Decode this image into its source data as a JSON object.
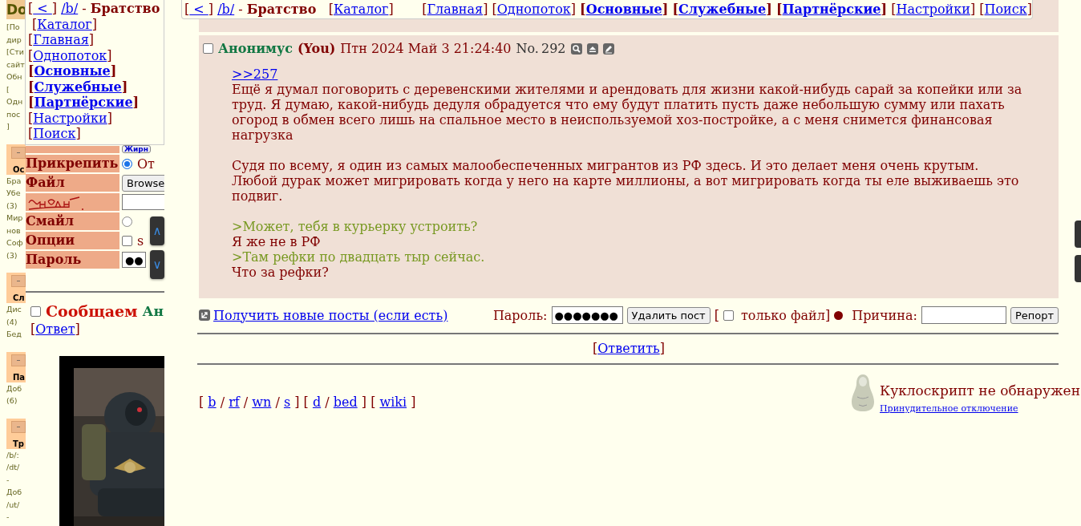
{
  "sidebar": {
    "title": "Do",
    "intro": [
      "[По",
      "дир",
      "[Сти",
      "сайт",
      "Обн",
      "[",
      "Одн",
      "пос",
      "]"
    ],
    "sections": [
      {
        "toggle": "–",
        "title": "Ос",
        "lines": [
          "Бра",
          "Убе",
          "(3)",
          "Мир",
          "нов",
          "Соф",
          "(3)"
        ]
      },
      {
        "toggle": "–",
        "title": "Сл",
        "lines": [
          "Дис",
          "(4)",
          "Бед"
        ]
      },
      {
        "toggle": "–",
        "title": "Па",
        "lines": [
          "Доб",
          "(6)"
        ]
      },
      {
        "toggle": "–",
        "title": "Тр",
        "lines": [
          "/b/:",
          "/dt/",
          "-",
          "Доб",
          "/ut/",
          "-"
        ]
      }
    ]
  },
  "menu": {
    "brackets": [
      "[",
      "]"
    ],
    "back": " < ",
    "board": "/b/",
    "sep": "-",
    "title": "Братство",
    "links": [
      {
        "label": "Каталог",
        "bold": false
      },
      {
        "label": "Главная",
        "bold": false
      },
      {
        "label": "Однопоток",
        "bold": false
      },
      {
        "label": "Основные",
        "bold": true
      },
      {
        "label": "Служебные",
        "bold": true
      },
      {
        "label": "Партнёрские",
        "bold": true
      },
      {
        "label": "Настройки",
        "bold": false
      },
      {
        "label": "Поиск",
        "bold": false
      }
    ]
  },
  "nav": {
    "brackets": [
      "[",
      "]"
    ],
    "back": " < ",
    "board": "/b/",
    "sep": "-",
    "title": "Братство",
    "links": [
      {
        "label": "Каталог",
        "bold": false
      },
      {
        "label": "Главная",
        "bold": false
      },
      {
        "label": "Однопоток",
        "bold": false
      },
      {
        "label": "Основные",
        "bold": true
      },
      {
        "label": "Служебные",
        "bold": true
      },
      {
        "label": "Партнёрские",
        "bold": true
      },
      {
        "label": "Настройки",
        "bold": false
      },
      {
        "label": "Поиск",
        "bold": false
      }
    ]
  },
  "form": {
    "top_button": "Жирн",
    "rows": [
      {
        "kind": "radio",
        "label": "Прикрепить",
        "text": "От",
        "selected": true
      },
      {
        "kind": "file",
        "label": "Файл",
        "text": "Browse"
      },
      {
        "kind": "captcha"
      },
      {
        "kind": "radio",
        "label": "Смайл",
        "selected": false
      },
      {
        "kind": "checkbox",
        "label": "Опции",
        "text": "s",
        "checked": false
      },
      {
        "kind": "password",
        "label": "Пароль",
        "value": "●●"
      }
    ],
    "scroll": [
      "∧",
      "∨"
    ]
  },
  "thread": {
    "subject": "Сообщаем",
    "name": "Ан",
    "brackets": [
      "[",
      "]"
    ],
    "reply": "Ответ",
    "checked": false
  },
  "post": {
    "checked": false,
    "name": "Анонимус",
    "you": "(You)",
    "date": "Птн 2024 Май 3 21:24:40",
    "no_label": "No.",
    "number": "292",
    "body": [
      {
        "kind": "link",
        "text": ">>257"
      },
      {
        "kind": "text",
        "text": "Ещё я думал поговорить с деревенскими жителями и арендовать для жизни какой-нибудь сарай за копейки или за труд. Я думаю, какой-нибудь дедуля обрадуется что ему будут платить пусть даже небольшую сумму или пахать огород в обмен всего лишь на спальное место в неиспользуемой хоз-постройке, а с меня снимется финансовая нагрузка"
      },
      {
        "kind": "break"
      },
      {
        "kind": "text",
        "text": "Судя по всему, я один из самых малообеспеченных мигрантов из РФ здесь. И это делает меня очень крутым."
      },
      {
        "kind": "text",
        "text": "Любой дурак может мигрировать когда у него на карте миллионы, а вот мигрировать когда ты еле выживаешь это подвиг."
      },
      {
        "kind": "break"
      },
      {
        "kind": "quote",
        "text": ">Может, тебя в курьерку устроить?"
      },
      {
        "kind": "text",
        "text": "Я же не в РФ"
      },
      {
        "kind": "quote",
        "text": ">Там рефки по двадцать тыр сейчас."
      },
      {
        "kind": "text",
        "text": "Что за рефки?"
      }
    ]
  },
  "actions": {
    "refresh": "Получить новые посты (если есть)",
    "password_label": "Пароль:",
    "password": "●●●●●●●",
    "delete": "Удалить пост",
    "open": "[",
    "file_only": "только файл]",
    "file_only_checked": false,
    "reason_label": "Причина:",
    "report": "Репорт"
  },
  "reply_link": {
    "brackets": [
      "[",
      "]"
    ],
    "label": "Ответить"
  },
  "boards": {
    "separator": "/",
    "brackets": [
      "[",
      "]"
    ],
    "groups": [
      [
        "b",
        "rf",
        "wn",
        "s"
      ],
      [
        "d",
        "bed"
      ],
      [
        "wiki"
      ]
    ]
  },
  "doll": {
    "status": "Куклоскрипт не обнаружен",
    "disable": "Принудительное отключение"
  }
}
